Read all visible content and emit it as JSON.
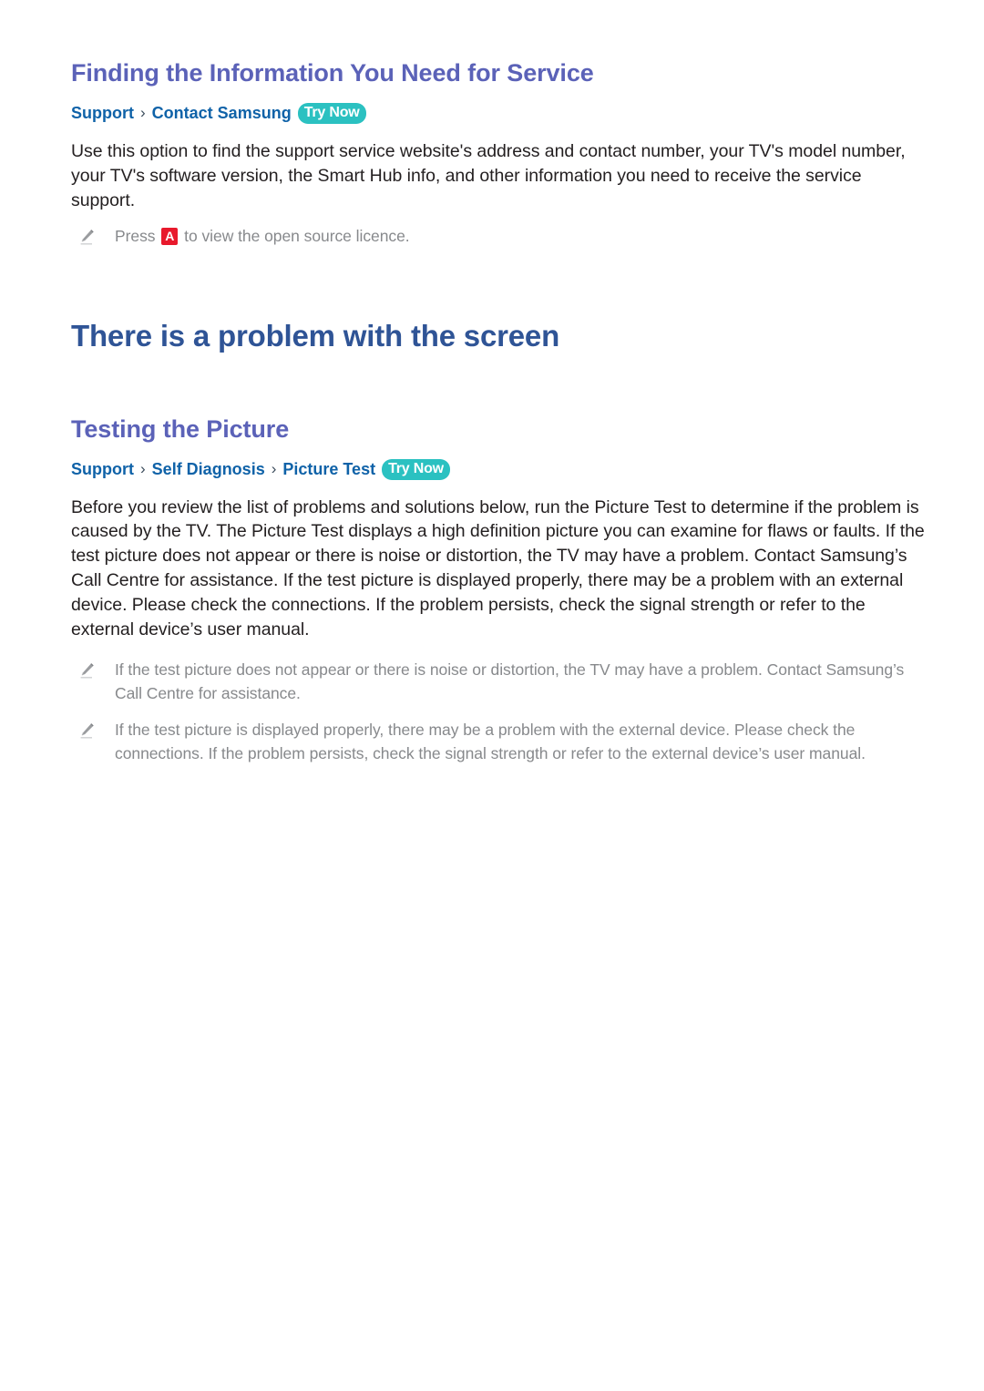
{
  "document": {
    "sections": [
      {
        "heading": "Finding the Information You Need for Service",
        "path": {
          "crumbs": [
            "Support",
            "Contact Samsung"
          ],
          "separator": "›",
          "badge": "Try Now"
        },
        "paragraph": "Use this option to find the support service website's address and contact number, your TV's model number, your TV's software version, the Smart Hub info, and other information you need to receive the service support.",
        "notes": [
          {
            "icon": "pencil-icon",
            "text_before_key": "Press ",
            "key": "A",
            "text_after_key": " to view the open source licence."
          }
        ]
      },
      {
        "title": "There is a problem with the screen"
      },
      {
        "heading": "Testing the Picture",
        "path": {
          "crumbs": [
            "Support",
            "Self Diagnosis",
            "Picture Test"
          ],
          "separator": "›",
          "badge": "Try Now"
        },
        "paragraph": "Before you review the list of problems and solutions below, run the Picture Test to determine if the problem is caused by the TV. The Picture Test displays a high definition picture you can examine for flaws or faults. If the test picture does not appear or there is noise or distortion, the TV may have a problem. Contact Samsung’s Call Centre for assistance. If the test picture is displayed properly, there may be a problem with an external device. Please check the connections. If the problem persists, check the signal strength or refer to the external device’s user manual.",
        "notes": [
          {
            "icon": "pencil-icon",
            "text": "If the test picture does not appear or there is noise or distortion, the TV may have a problem. Contact Samsung’s Call Centre for assistance."
          },
          {
            "icon": "pencil-icon",
            "text": "If the test picture is displayed properly, there may be a problem with the external device. Please check the connections. If the problem persists, check the signal strength or refer to the external device’s user manual."
          }
        ]
      }
    ]
  },
  "colors": {
    "subheading": "#5b62b8",
    "title": "#2f5496",
    "path_link": "#0f62a8",
    "badge_bg": "#2bc1c1",
    "key_badge_bg": "#e8192c",
    "body_text": "#231f20",
    "note_text": "#87898c"
  }
}
